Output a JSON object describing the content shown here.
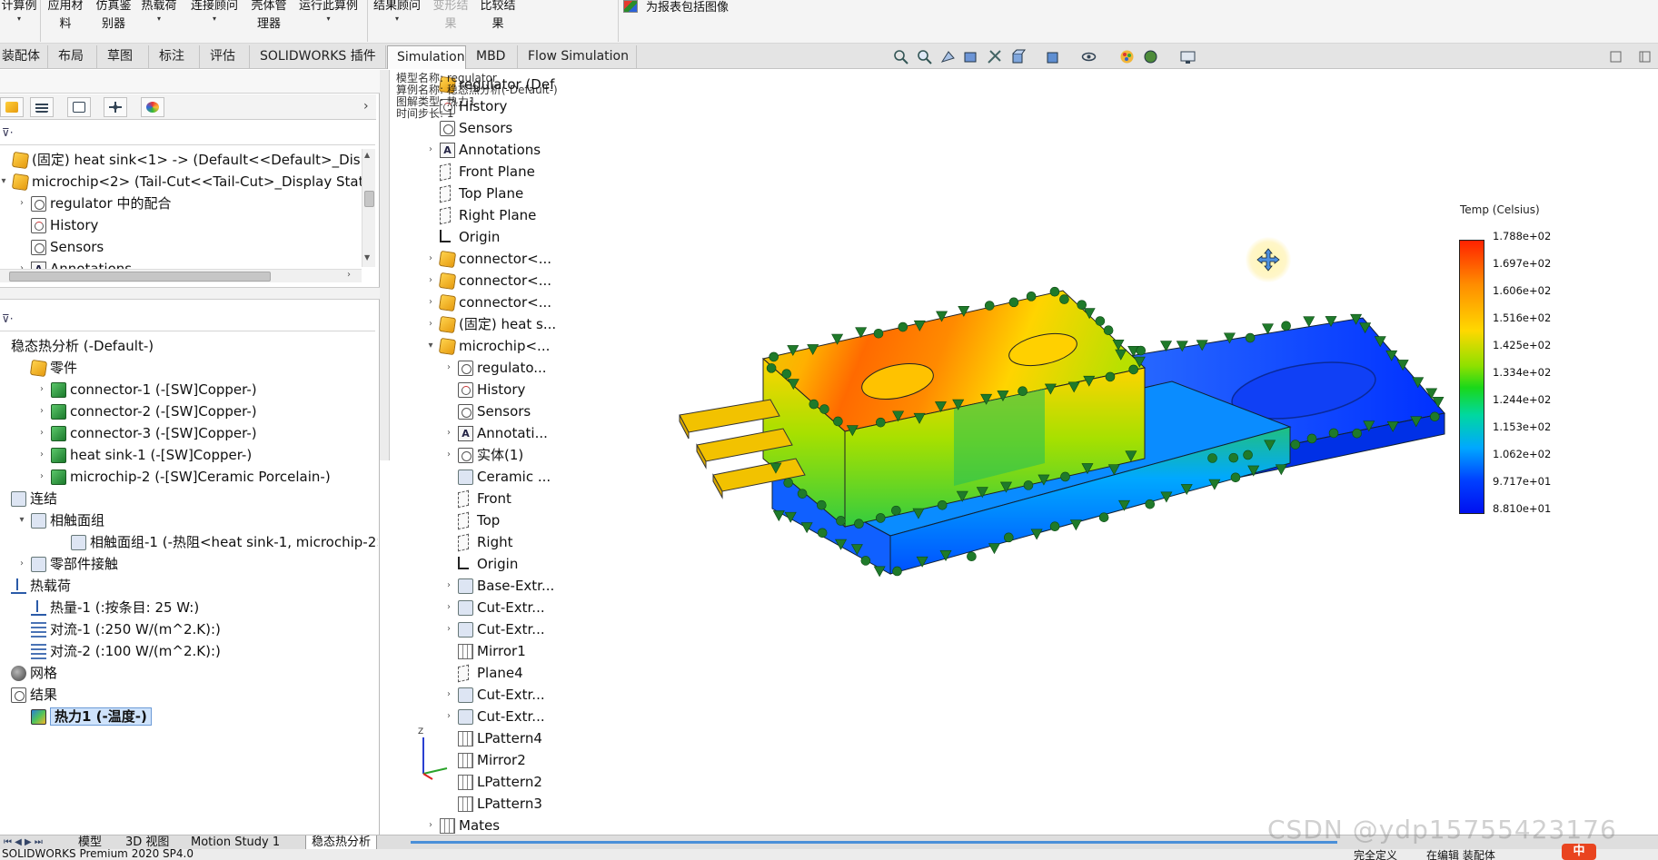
{
  "ribbon": {
    "items": [
      {
        "label": "计算例",
        "sub": "",
        "dropdown": true
      },
      {
        "label": "应用材",
        "sub": "料",
        "dropdown": false
      },
      {
        "label": "仿真鉴",
        "sub": "别器",
        "dropdown": false
      },
      {
        "label": "热载荷",
        "sub": "",
        "dropdown": true
      },
      {
        "label": "连接顾问",
        "sub": "",
        "dropdown": true
      },
      {
        "label": "壳体管",
        "sub": "理器",
        "dropdown": false
      },
      {
        "label": "运行此算例",
        "sub": "",
        "dropdown": true
      },
      {
        "label": "结果顾问",
        "sub": "",
        "dropdown": true
      },
      {
        "label": "变形结",
        "sub": "果",
        "dropdown": false,
        "disabled": true
      },
      {
        "label": "比较结",
        "sub": "果",
        "dropdown": false
      }
    ],
    "report_label": "为报表包括图像"
  },
  "tabs": [
    {
      "label": "装配体",
      "active": false
    },
    {
      "label": "布局",
      "active": false
    },
    {
      "label": "草图",
      "active": false
    },
    {
      "label": "标注",
      "active": false
    },
    {
      "label": "评估",
      "active": false
    },
    {
      "label": "SOLIDWORKS 插件",
      "active": false
    },
    {
      "label": "Simulation",
      "active": true
    },
    {
      "label": "MBD",
      "active": false
    },
    {
      "label": "Flow Simulation",
      "active": false
    }
  ],
  "feature_tree": [
    {
      "label": "(固定) heat sink<1> -> (Default<<Default>_Display",
      "icon": "part",
      "expand": "",
      "indent": 0
    },
    {
      "label": "microchip<2> (Tail-Cut<<Tail-Cut>_Display State",
      "icon": "part",
      "expand": "▾",
      "indent": 0
    },
    {
      "label": "regulator 中的配合",
      "icon": "folder",
      "expand": "›",
      "indent": 1
    },
    {
      "label": "History",
      "icon": "hist",
      "expand": "",
      "indent": 1
    },
    {
      "label": "Sensors",
      "icon": "folder",
      "expand": "",
      "indent": 1
    },
    {
      "label": "Annotations",
      "icon": "ann",
      "expand": "›",
      "indent": 1
    }
  ],
  "study_tree": [
    {
      "label": "稳态热分析 (-Default-)",
      "icon": "none",
      "expand": "",
      "indent": 0
    },
    {
      "label": "零件",
      "icon": "part",
      "expand": "",
      "indent": 1
    },
    {
      "label": "connector-1 (-[SW]Copper-)",
      "icon": "green",
      "expand": "›",
      "indent": 2
    },
    {
      "label": "connector-2 (-[SW]Copper-)",
      "icon": "green",
      "expand": "›",
      "indent": 2
    },
    {
      "label": "connector-3 (-[SW]Copper-)",
      "icon": "green",
      "expand": "›",
      "indent": 2
    },
    {
      "label": "heat sink-1 (-[SW]Copper-)",
      "icon": "green",
      "expand": "›",
      "indent": 2
    },
    {
      "label": "microchip-2 (-[SW]Ceramic Porcelain-)",
      "icon": "green",
      "expand": "›",
      "indent": 2
    },
    {
      "label": "连结",
      "icon": "feat",
      "expand": "",
      "indent": 0
    },
    {
      "label": "相触面组",
      "icon": "feat",
      "expand": "▾",
      "indent": 1
    },
    {
      "label": "相触面组-1 (-热阻<heat sink-1, microchip-2>-)",
      "icon": "feat",
      "expand": "",
      "indent": 3
    },
    {
      "label": "零部件接触",
      "icon": "feat",
      "expand": "›",
      "indent": 1
    },
    {
      "label": "热载荷",
      "icon": "load",
      "expand": "",
      "indent": 0
    },
    {
      "label": "热量-1 (:按条目: 25 W:)",
      "icon": "load",
      "expand": "",
      "indent": 1
    },
    {
      "label": "对流-1 (:250 W/(m^2.K):)",
      "icon": "conv",
      "expand": "",
      "indent": 1
    },
    {
      "label": "对流-2 (:100 W/(m^2.K):)",
      "icon": "conv",
      "expand": "",
      "indent": 1
    },
    {
      "label": "网格",
      "icon": "mesh",
      "expand": "",
      "indent": 0
    },
    {
      "label": "结果",
      "icon": "folder",
      "expand": "",
      "indent": 0
    },
    {
      "label": "热力1 (-温度-)",
      "icon": "res",
      "expand": "",
      "indent": 1,
      "selected": true
    }
  ],
  "flyout": [
    {
      "label": "regulator (Def",
      "icon": "part",
      "expand": "",
      "indent": 0
    },
    {
      "label": "History",
      "icon": "hist",
      "expand": "",
      "indent": 0
    },
    {
      "label": "Sensors",
      "icon": "folder",
      "expand": "",
      "indent": 0
    },
    {
      "label": "Annotations",
      "icon": "ann",
      "expand": "›",
      "indent": 0
    },
    {
      "label": "Front Plane",
      "icon": "plane",
      "expand": "",
      "indent": 0
    },
    {
      "label": "Top Plane",
      "icon": "plane",
      "expand": "",
      "indent": 0
    },
    {
      "label": "Right Plane",
      "icon": "plane",
      "expand": "",
      "indent": 0
    },
    {
      "label": "Origin",
      "icon": "origin",
      "expand": "",
      "indent": 0
    },
    {
      "label": "connector<...",
      "icon": "part",
      "expand": "›",
      "indent": 0
    },
    {
      "label": "connector<...",
      "icon": "part",
      "expand": "›",
      "indent": 0
    },
    {
      "label": "connector<...",
      "icon": "part",
      "expand": "›",
      "indent": 0
    },
    {
      "label": "(固定) heat s...",
      "icon": "part",
      "expand": "›",
      "indent": 0
    },
    {
      "label": "microchip<...",
      "icon": "part",
      "expand": "▾",
      "indent": 0
    },
    {
      "label": "regulato...",
      "icon": "folder",
      "expand": "›",
      "indent": 1
    },
    {
      "label": "History",
      "icon": "hist",
      "expand": "",
      "indent": 1
    },
    {
      "label": "Sensors",
      "icon": "folder",
      "expand": "",
      "indent": 1
    },
    {
      "label": "Annotati...",
      "icon": "ann",
      "expand": "›",
      "indent": 1
    },
    {
      "label": "实体(1)",
      "icon": "folder",
      "expand": "›",
      "indent": 1
    },
    {
      "label": "Ceramic ...",
      "icon": "feat",
      "expand": "",
      "indent": 1
    },
    {
      "label": "Front",
      "icon": "plane",
      "expand": "",
      "indent": 1
    },
    {
      "label": "Top",
      "icon": "plane",
      "expand": "",
      "indent": 1
    },
    {
      "label": "Right",
      "icon": "plane",
      "expand": "",
      "indent": 1
    },
    {
      "label": "Origin",
      "icon": "origin",
      "expand": "",
      "indent": 1
    },
    {
      "label": "Base-Extr...",
      "icon": "feat",
      "expand": "›",
      "indent": 1
    },
    {
      "label": "Cut-Extr...",
      "icon": "feat",
      "expand": "›",
      "indent": 1
    },
    {
      "label": "Cut-Extr...",
      "icon": "feat",
      "expand": "›",
      "indent": 1
    },
    {
      "label": "Mirror1",
      "icon": "pat",
      "expand": "",
      "indent": 1
    },
    {
      "label": "Plane4",
      "icon": "plane",
      "expand": "",
      "indent": 1
    },
    {
      "label": "Cut-Extr...",
      "icon": "feat",
      "expand": "›",
      "indent": 1
    },
    {
      "label": "Cut-Extr...",
      "icon": "feat",
      "expand": "›",
      "indent": 1
    },
    {
      "label": "LPattern4",
      "icon": "pat",
      "expand": "",
      "indent": 1
    },
    {
      "label": "Mirror2",
      "icon": "pat",
      "expand": "",
      "indent": 1
    },
    {
      "label": "LPattern2",
      "icon": "pat",
      "expand": "",
      "indent": 1
    },
    {
      "label": "LPattern3",
      "icon": "pat",
      "expand": "",
      "indent": 1
    },
    {
      "label": "Mates",
      "icon": "pat",
      "expand": "›",
      "indent": 0
    }
  ],
  "overlay": {
    "lines": [
      "模型名称: regulator",
      "算例名称: 稳态热分析(-Default-)",
      "图解类型: 热力1",
      "时间步长: 1"
    ]
  },
  "legend": {
    "title": "Temp (Celsius)",
    "values": [
      "1.788e+02",
      "1.697e+02",
      "1.606e+02",
      "1.516e+02",
      "1.425e+02",
      "1.334e+02",
      "1.244e+02",
      "1.153e+02",
      "1.062e+02",
      "9.717e+01",
      "8.810e+01"
    ]
  },
  "triad": {
    "axis_label": "Z"
  },
  "bottom_tabs": [
    {
      "label": "模型",
      "active": false
    },
    {
      "label": "3D 视图",
      "active": false
    },
    {
      "label": "Motion Study 1",
      "active": false
    },
    {
      "label": "稳态热分析",
      "active": true
    }
  ],
  "status": {
    "left": "SOLIDWORKS Premium 2020 SP4.0",
    "mid1": "完全定义",
    "mid2": "在编辑 装配体"
  },
  "watermark": "CSDN @ydp15755423176",
  "ime_label": "中"
}
